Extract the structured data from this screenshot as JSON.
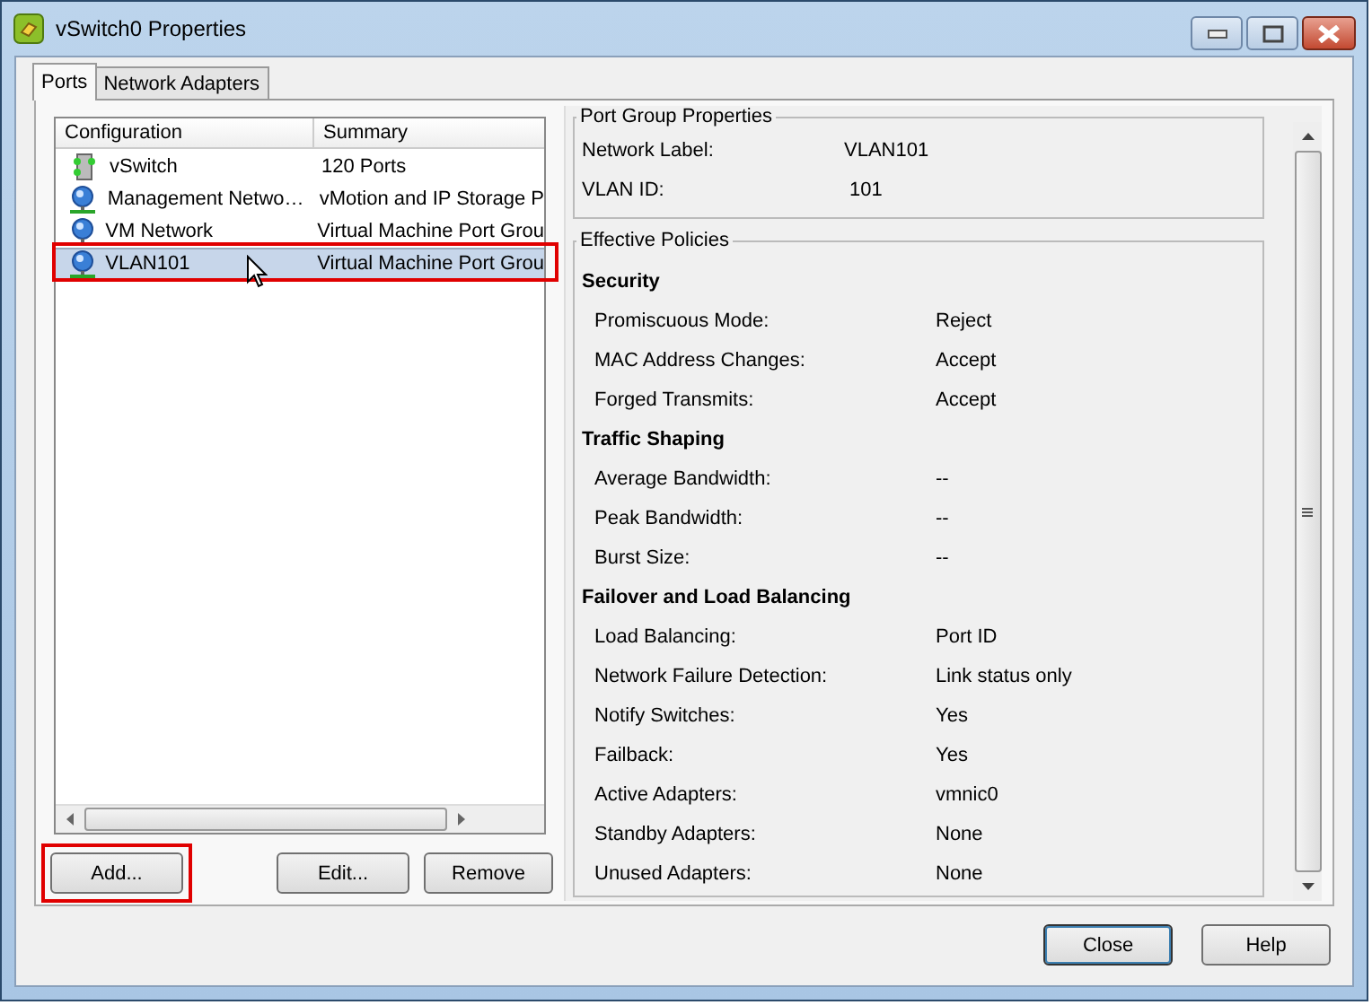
{
  "window": {
    "title": "vSwitch0 Properties"
  },
  "tabs": [
    {
      "label": "Ports",
      "selected": true
    },
    {
      "label": "Network Adapters",
      "selected": false
    }
  ],
  "ports_table": {
    "columns": [
      "Configuration",
      "Summary"
    ],
    "rows": [
      {
        "kind": "switch",
        "configuration": "vSwitch",
        "summary": "120 Ports",
        "selected": false,
        "highlighted": false
      },
      {
        "kind": "portgroup",
        "configuration": "Management Netwo…",
        "summary": "vMotion and IP Storage P",
        "selected": false,
        "highlighted": false
      },
      {
        "kind": "portgroup",
        "configuration": "VM Network",
        "summary": "Virtual Machine Port Grou",
        "selected": false,
        "highlighted": false
      },
      {
        "kind": "portgroup",
        "configuration": "VLAN101",
        "summary": "Virtual Machine Port Grou",
        "selected": true,
        "highlighted": true
      }
    ]
  },
  "list_buttons": [
    {
      "label": "Add...",
      "highlighted": true
    },
    {
      "label": "Edit...",
      "highlighted": false
    },
    {
      "label": "Remove",
      "highlighted": false
    }
  ],
  "port_group_properties": {
    "title": "Port Group Properties",
    "fields": [
      {
        "label": "Network Label:",
        "value": "VLAN101"
      },
      {
        "label": "VLAN ID:",
        "value": "101"
      }
    ]
  },
  "effective_policies": {
    "title": "Effective Policies",
    "sections": [
      {
        "heading": "Security",
        "fields": [
          {
            "label": "Promiscuous Mode:",
            "value": "Reject"
          },
          {
            "label": "MAC Address Changes:",
            "value": "Accept"
          },
          {
            "label": "Forged Transmits:",
            "value": "Accept"
          }
        ]
      },
      {
        "heading": "Traffic Shaping",
        "fields": [
          {
            "label": "Average Bandwidth:",
            "value": "--"
          },
          {
            "label": "Peak Bandwidth:",
            "value": "--"
          },
          {
            "label": "Burst Size:",
            "value": "--"
          }
        ]
      },
      {
        "heading": "Failover and Load Balancing",
        "fields": [
          {
            "label": "Load Balancing:",
            "value": "Port ID"
          },
          {
            "label": "Network Failure Detection:",
            "value": "Link status only"
          },
          {
            "label": "Notify Switches:",
            "value": "Yes"
          },
          {
            "label": "Failback:",
            "value": "Yes"
          },
          {
            "label": "Active Adapters:",
            "value": "vmnic0"
          },
          {
            "label": "Standby Adapters:",
            "value": "None"
          },
          {
            "label": "Unused Adapters:",
            "value": "None"
          }
        ]
      }
    ]
  },
  "dialog_buttons": [
    "Close",
    "Help"
  ]
}
